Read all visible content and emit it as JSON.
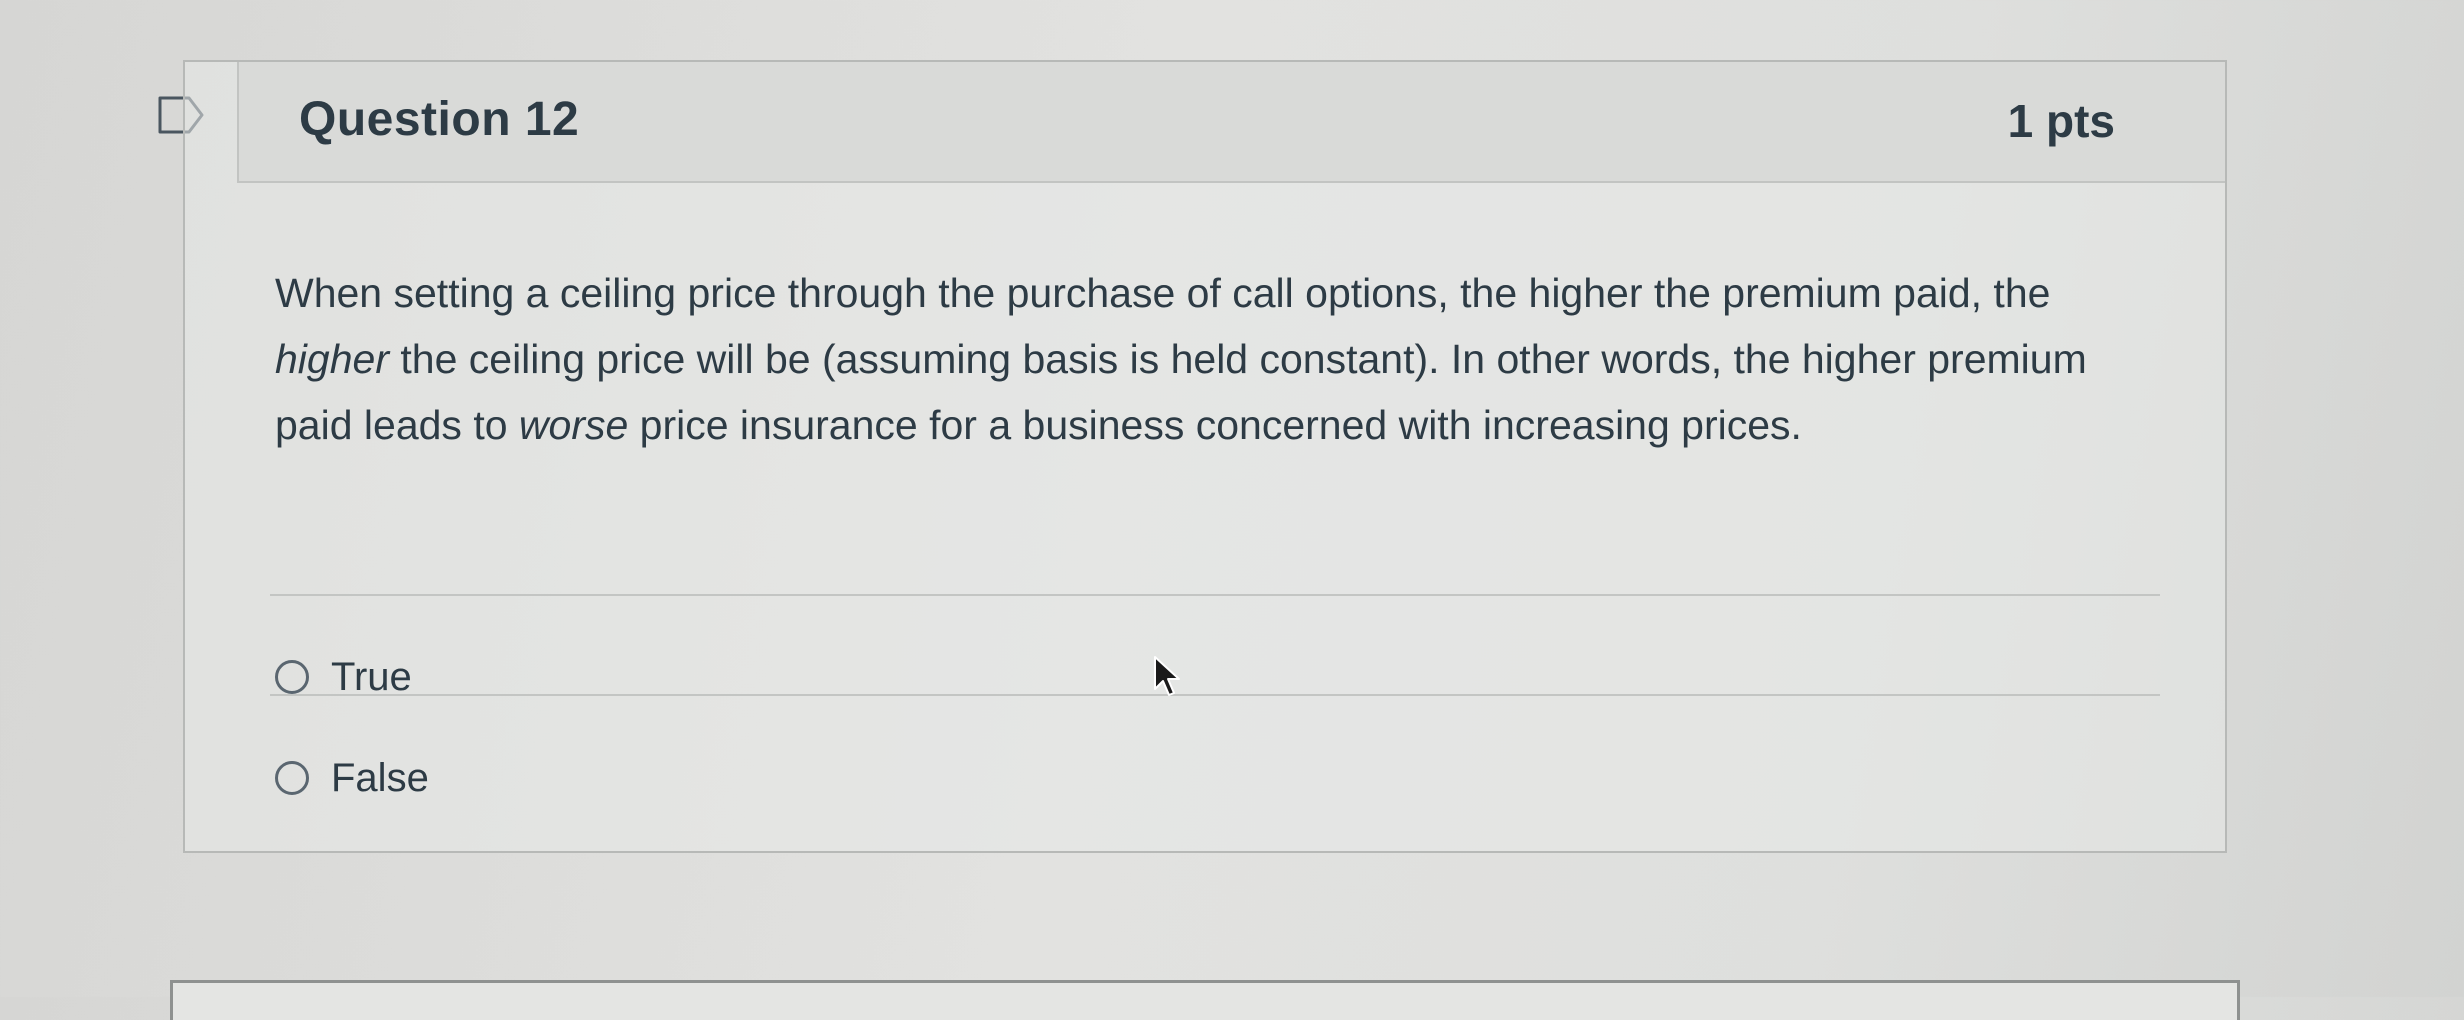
{
  "question": {
    "title": "Question 12",
    "points": "1 pts",
    "text_parts": {
      "p1": "When setting a ceiling price through the purchase of call options, the higher the premium paid, the ",
      "em1": "higher",
      "p2": " the ceiling price will be (assuming basis is held constant).  In other words, the higher premium paid leads to ",
      "em2": "worse",
      "p3": " price insurance for a business concerned with increasing prices."
    },
    "answers": [
      {
        "label": "True",
        "selected": false
      },
      {
        "label": "False",
        "selected": false
      }
    ]
  },
  "icons": {
    "flag": "bookmark-flag-icon",
    "cursor": "mouse-pointer-icon"
  },
  "colors": {
    "text": "#2d3b45",
    "header_bg": "#d9dad8",
    "border": "#b7b9b7"
  }
}
